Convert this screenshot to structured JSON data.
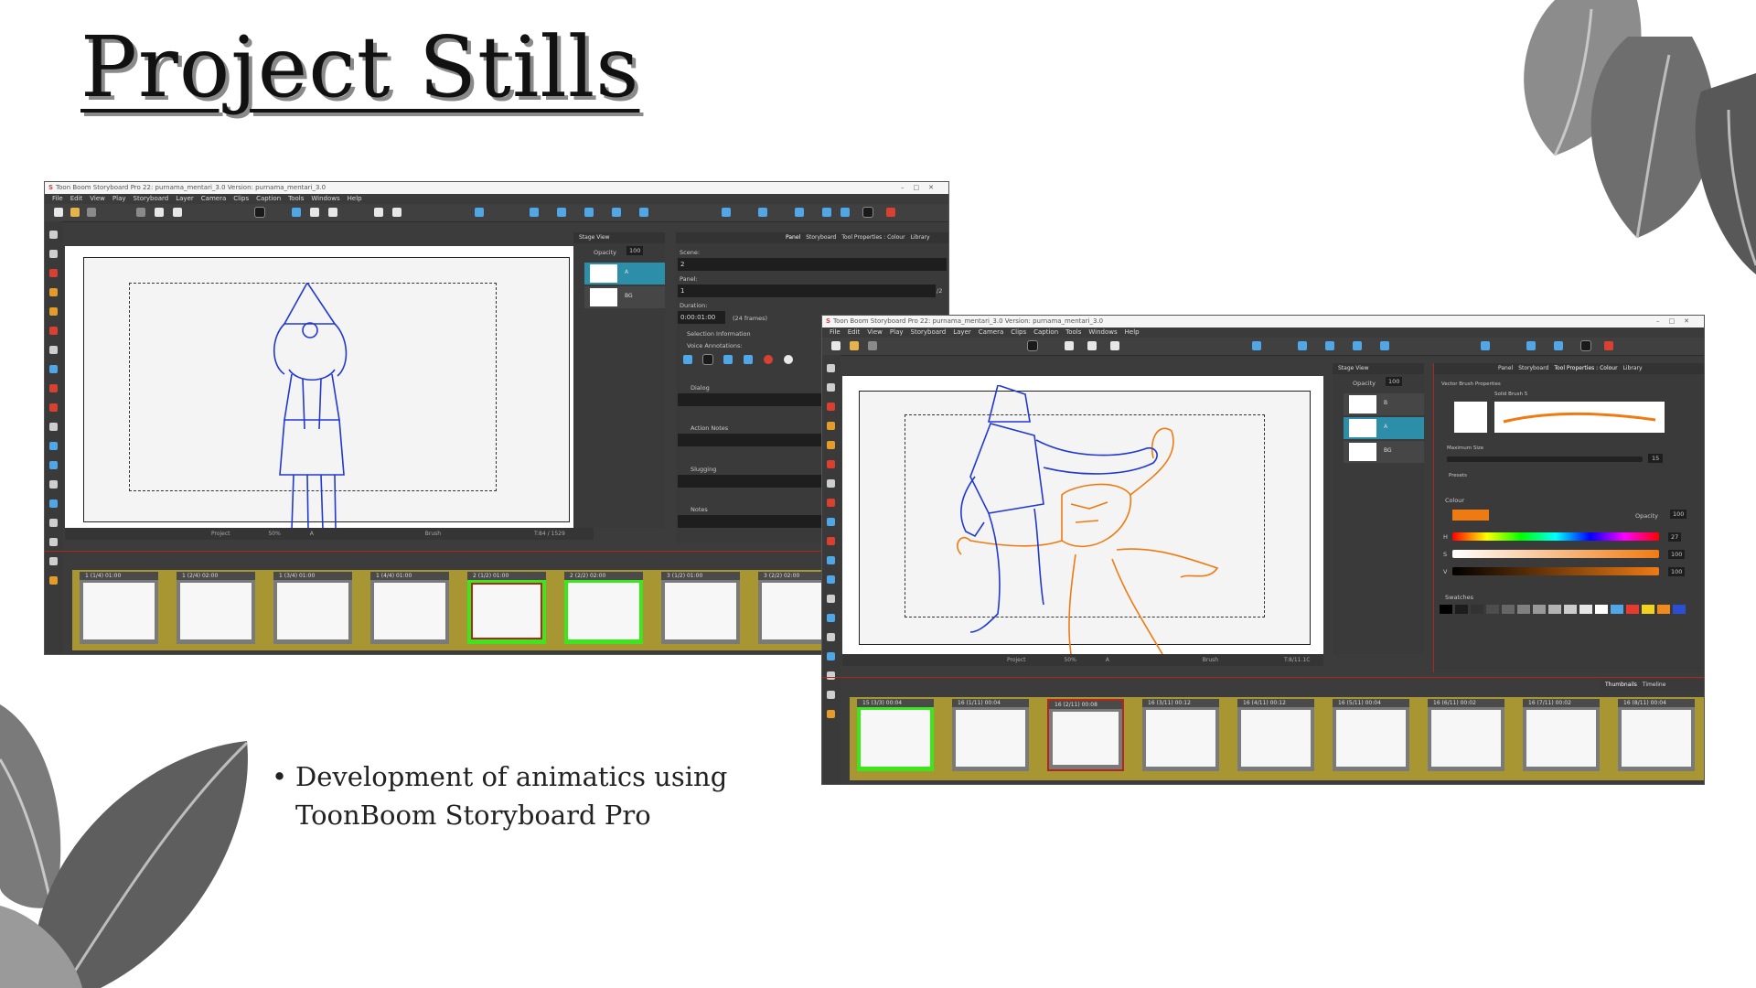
{
  "slide": {
    "title": "Project Stills",
    "bullet_lines": [
      "Development of animatics using",
      "ToonBoom Storyboard Pro"
    ]
  },
  "window1": {
    "title": "Toon Boom Storyboard Pro 22: purnama_mentari_3.0 Version: purnama_mentari_3.0",
    "menu": [
      "File",
      "Edit",
      "View",
      "Play",
      "Storyboard",
      "Layer",
      "Camera",
      "Clips",
      "Caption",
      "Tools",
      "Windows",
      "Help"
    ],
    "stage_view_label": "Stage View",
    "opacity_label": "Opacity",
    "opacity_value": "100",
    "layers": [
      {
        "name": "A"
      },
      {
        "name": "BG"
      }
    ],
    "tabs": [
      "Panel",
      "Storyboard",
      "Tool Properties : Colour",
      "Library"
    ],
    "scene_label": "Scene:",
    "scene_value": "2",
    "panel_label": "Panel:",
    "panel_value": "1",
    "panel_of": "/2",
    "duration_label": "Duration:",
    "duration_value": "0:00:01:00",
    "duration_frames": "(24 frames)",
    "selection_info": "Selection Information",
    "voice_annotations": "Voice Annotations:",
    "dialog": "Dialog",
    "action_notes": "Action Notes",
    "slugging": "Slugging",
    "notes": "Notes",
    "status": {
      "project": "Project",
      "zoom": "50%",
      "layer": "A",
      "tool": "Brush",
      "coords": "T:84 / 1529"
    },
    "thumbs": [
      {
        "label": "1 (1/4) 01:00",
        "state": "normal"
      },
      {
        "label": "1 (2/4) 02:00",
        "state": "normal"
      },
      {
        "label": "1 (3/4) 01:00",
        "state": "normal"
      },
      {
        "label": "1 (4/4) 01:00",
        "state": "normal"
      },
      {
        "label": "2 (1/2) 01:00",
        "state": "selected"
      },
      {
        "label": "2 (2/2) 02:00",
        "state": "current"
      },
      {
        "label": "3 (1/2) 01:00",
        "state": "normal"
      },
      {
        "label": "3 (2/2) 02:00",
        "state": "normal"
      }
    ]
  },
  "window2": {
    "title": "Toon Boom Storyboard Pro 22: purnama_mentari_3.0 Version: purnama_mentari_3.0",
    "menu": [
      "File",
      "Edit",
      "View",
      "Play",
      "Storyboard",
      "Layer",
      "Camera",
      "Clips",
      "Caption",
      "Tools",
      "Windows",
      "Help"
    ],
    "stage_view_label": "Stage View",
    "opacity_label": "Opacity",
    "opacity_value": "100",
    "layers": [
      {
        "name": "B"
      },
      {
        "name": "A"
      },
      {
        "name": "BG"
      }
    ],
    "tabs": [
      "Panel",
      "Storyboard",
      "Tool Properties : Colour",
      "Library"
    ],
    "brush_props": "Vector Brush Properties",
    "brush_name": "Solid Brush 5",
    "max_size_label": "Maximum Size",
    "max_size_value": "15",
    "presets": "Presets",
    "colour_label": "Colour",
    "colour_opacity_label": "Opacity",
    "colour_opacity_value": "100",
    "h_label": "H",
    "h_value": "27",
    "s_label": "S",
    "s_value": "100",
    "v_label": "V",
    "v_value": "100",
    "swatches_label": "Swatches",
    "swatches": [
      "#000000",
      "#1c1c1c",
      "#333333",
      "#4d4d4d",
      "#666666",
      "#808080",
      "#999999",
      "#b3b3b3",
      "#cccccc",
      "#e6e6e6",
      "#ffffff",
      "#4fa7e8",
      "#e63b2e",
      "#f2d21b",
      "#f08a1c",
      "#2a4fd6"
    ],
    "colour_swatch": "#f07a12",
    "bottom_tabs": [
      "Thumbnails",
      "Timeline"
    ],
    "status": {
      "project": "Project",
      "zoom": "50%",
      "layer": "A",
      "tool": "Brush",
      "coords": "T:8/11.1C"
    },
    "thumbs": [
      {
        "label": "15 (3/3) 00:04",
        "state": "current"
      },
      {
        "label": "16 (1/11) 00:04",
        "state": "normal"
      },
      {
        "label": "16 (2/11) 00:08",
        "state": "selected"
      },
      {
        "label": "16 (3/11) 00:12",
        "state": "normal"
      },
      {
        "label": "16 (4/11) 00:12",
        "state": "normal"
      },
      {
        "label": "16 (5/11) 00:04",
        "state": "normal"
      },
      {
        "label": "16 (6/11) 00:02",
        "state": "normal"
      },
      {
        "label": "16 (7/11) 00:02",
        "state": "normal"
      },
      {
        "label": "16 (8/11) 00:04",
        "state": "normal"
      }
    ]
  }
}
